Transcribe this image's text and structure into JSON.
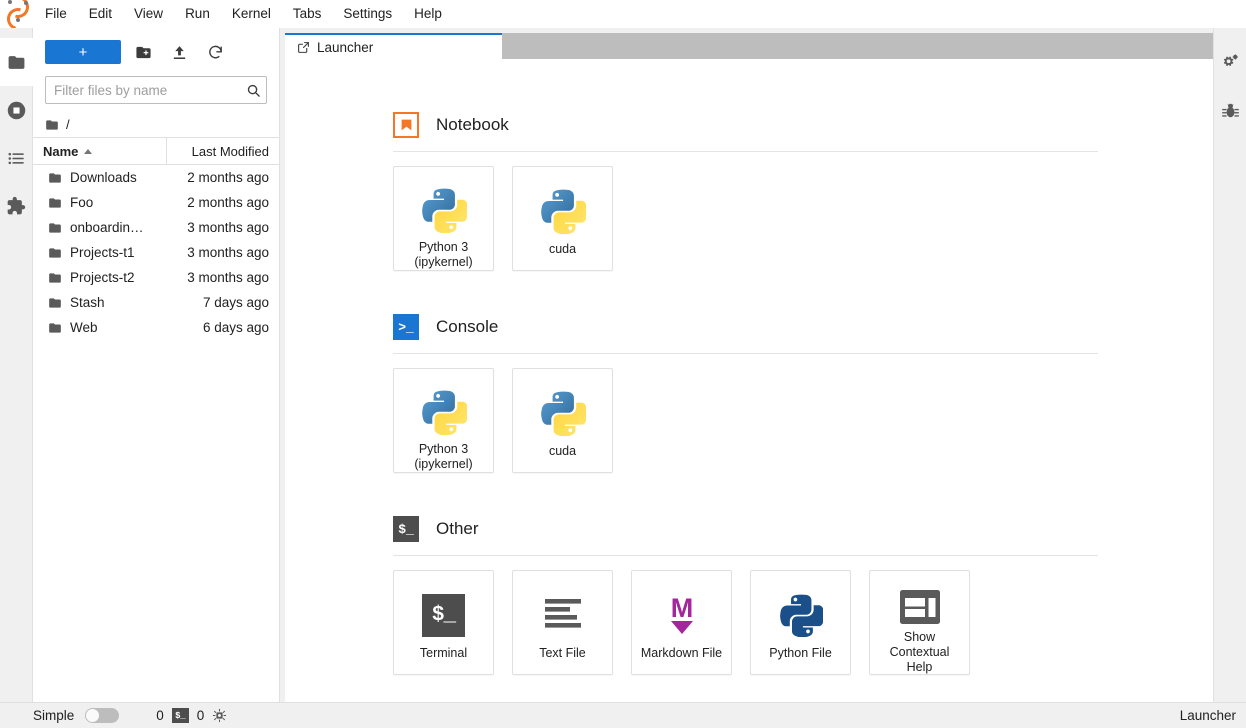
{
  "window": {
    "app_name": "JupyterLab",
    "logo_icon": "jupyter-logo",
    "accent_color": "#1976d2",
    "brand_color": "#f37726"
  },
  "menubar": {
    "items": [
      {
        "label": "File"
      },
      {
        "label": "Edit"
      },
      {
        "label": "View"
      },
      {
        "label": "Run"
      },
      {
        "label": "Kernel"
      },
      {
        "label": "Tabs"
      },
      {
        "label": "Settings"
      },
      {
        "label": "Help"
      }
    ]
  },
  "left_sidebar": {
    "items": [
      {
        "icon": "folder-icon",
        "name": "file-browser",
        "active": true
      },
      {
        "icon": "running-terminals-icon",
        "name": "running-sessions",
        "active": false
      },
      {
        "icon": "list-icon",
        "name": "table-of-contents",
        "active": false
      },
      {
        "icon": "puzzle-piece-icon",
        "name": "extension-manager",
        "active": false
      }
    ]
  },
  "right_sidebar": {
    "items": [
      {
        "icon": "gears-icon",
        "name": "property-inspector"
      },
      {
        "icon": "bug-icon",
        "name": "debugger"
      }
    ]
  },
  "file_browser": {
    "toolbar": {
      "new_launcher_label": "+",
      "new_folder_icon": "new-folder-icon",
      "upload_icon": "upload-icon",
      "refresh_icon": "refresh-icon"
    },
    "filter": {
      "placeholder": "Filter files by name",
      "value": "",
      "search_icon": "search-icon"
    },
    "breadcrumb": {
      "root_icon": "folder-icon",
      "path": "/"
    },
    "columns": [
      {
        "label": "Name",
        "sort": "ascending"
      },
      {
        "label": "Last Modified"
      }
    ],
    "rows": [
      {
        "icon": "folder-icon",
        "name": "Downloads",
        "modified": "2 months ago"
      },
      {
        "icon": "folder-icon",
        "name": "Foo",
        "modified": "2 months ago"
      },
      {
        "icon": "folder-icon",
        "name": "onboardin…",
        "modified": "3 months ago"
      },
      {
        "icon": "folder-icon",
        "name": "Projects-t1",
        "modified": "3 months ago"
      },
      {
        "icon": "folder-icon",
        "name": "Projects-t2",
        "modified": "3 months ago"
      },
      {
        "icon": "folder-icon",
        "name": "Stash",
        "modified": "7 days ago"
      },
      {
        "icon": "folder-icon",
        "name": "Web",
        "modified": "6 days ago"
      }
    ]
  },
  "dock": {
    "tabs": [
      {
        "label": "Launcher",
        "icon": "launcher-icon",
        "active": true
      }
    ]
  },
  "launcher": {
    "sections": [
      {
        "title": "Notebook",
        "icon": "notebook-icon",
        "cards": [
          {
            "label": "Python 3\n(ipykernel)",
            "label_line1": "Python 3",
            "label_line2": "(ipykernel)",
            "icon": "python-logo-icon"
          },
          {
            "label": "cuda",
            "label_line1": "cuda",
            "label_line2": "",
            "icon": "python-logo-icon"
          }
        ]
      },
      {
        "title": "Console",
        "icon": "console-icon",
        "cards": [
          {
            "label": "Python 3\n(ipykernel)",
            "label_line1": "Python 3",
            "label_line2": "(ipykernel)",
            "icon": "python-logo-icon"
          },
          {
            "label": "cuda",
            "label_line1": "cuda",
            "label_line2": "",
            "icon": "python-logo-icon"
          }
        ]
      },
      {
        "title": "Other",
        "icon": "terminal-prompt-icon",
        "cards": [
          {
            "label": "Terminal",
            "label_line1": "Terminal",
            "label_line2": "",
            "icon": "terminal-icon"
          },
          {
            "label": "Text File",
            "label_line1": "Text File",
            "label_line2": "",
            "icon": "text-file-icon"
          },
          {
            "label": "Markdown File",
            "label_line1": "Markdown File",
            "label_line2": "",
            "icon": "markdown-icon"
          },
          {
            "label": "Python File",
            "label_line1": "Python File",
            "label_line2": "",
            "icon": "python-file-icon"
          },
          {
            "label": "Show Contextual Help",
            "label_line1": "Show Contextual",
            "label_line2": "Help",
            "icon": "contextual-help-icon"
          }
        ]
      }
    ]
  },
  "statusbar": {
    "mode_label": "Simple",
    "mode_enabled": false,
    "kernel_count": "0",
    "terminal_icon": "terminal-badge-icon",
    "terminal_count": "0",
    "kernel_icon": "kernel-chip-icon",
    "active_item": "Launcher"
  }
}
